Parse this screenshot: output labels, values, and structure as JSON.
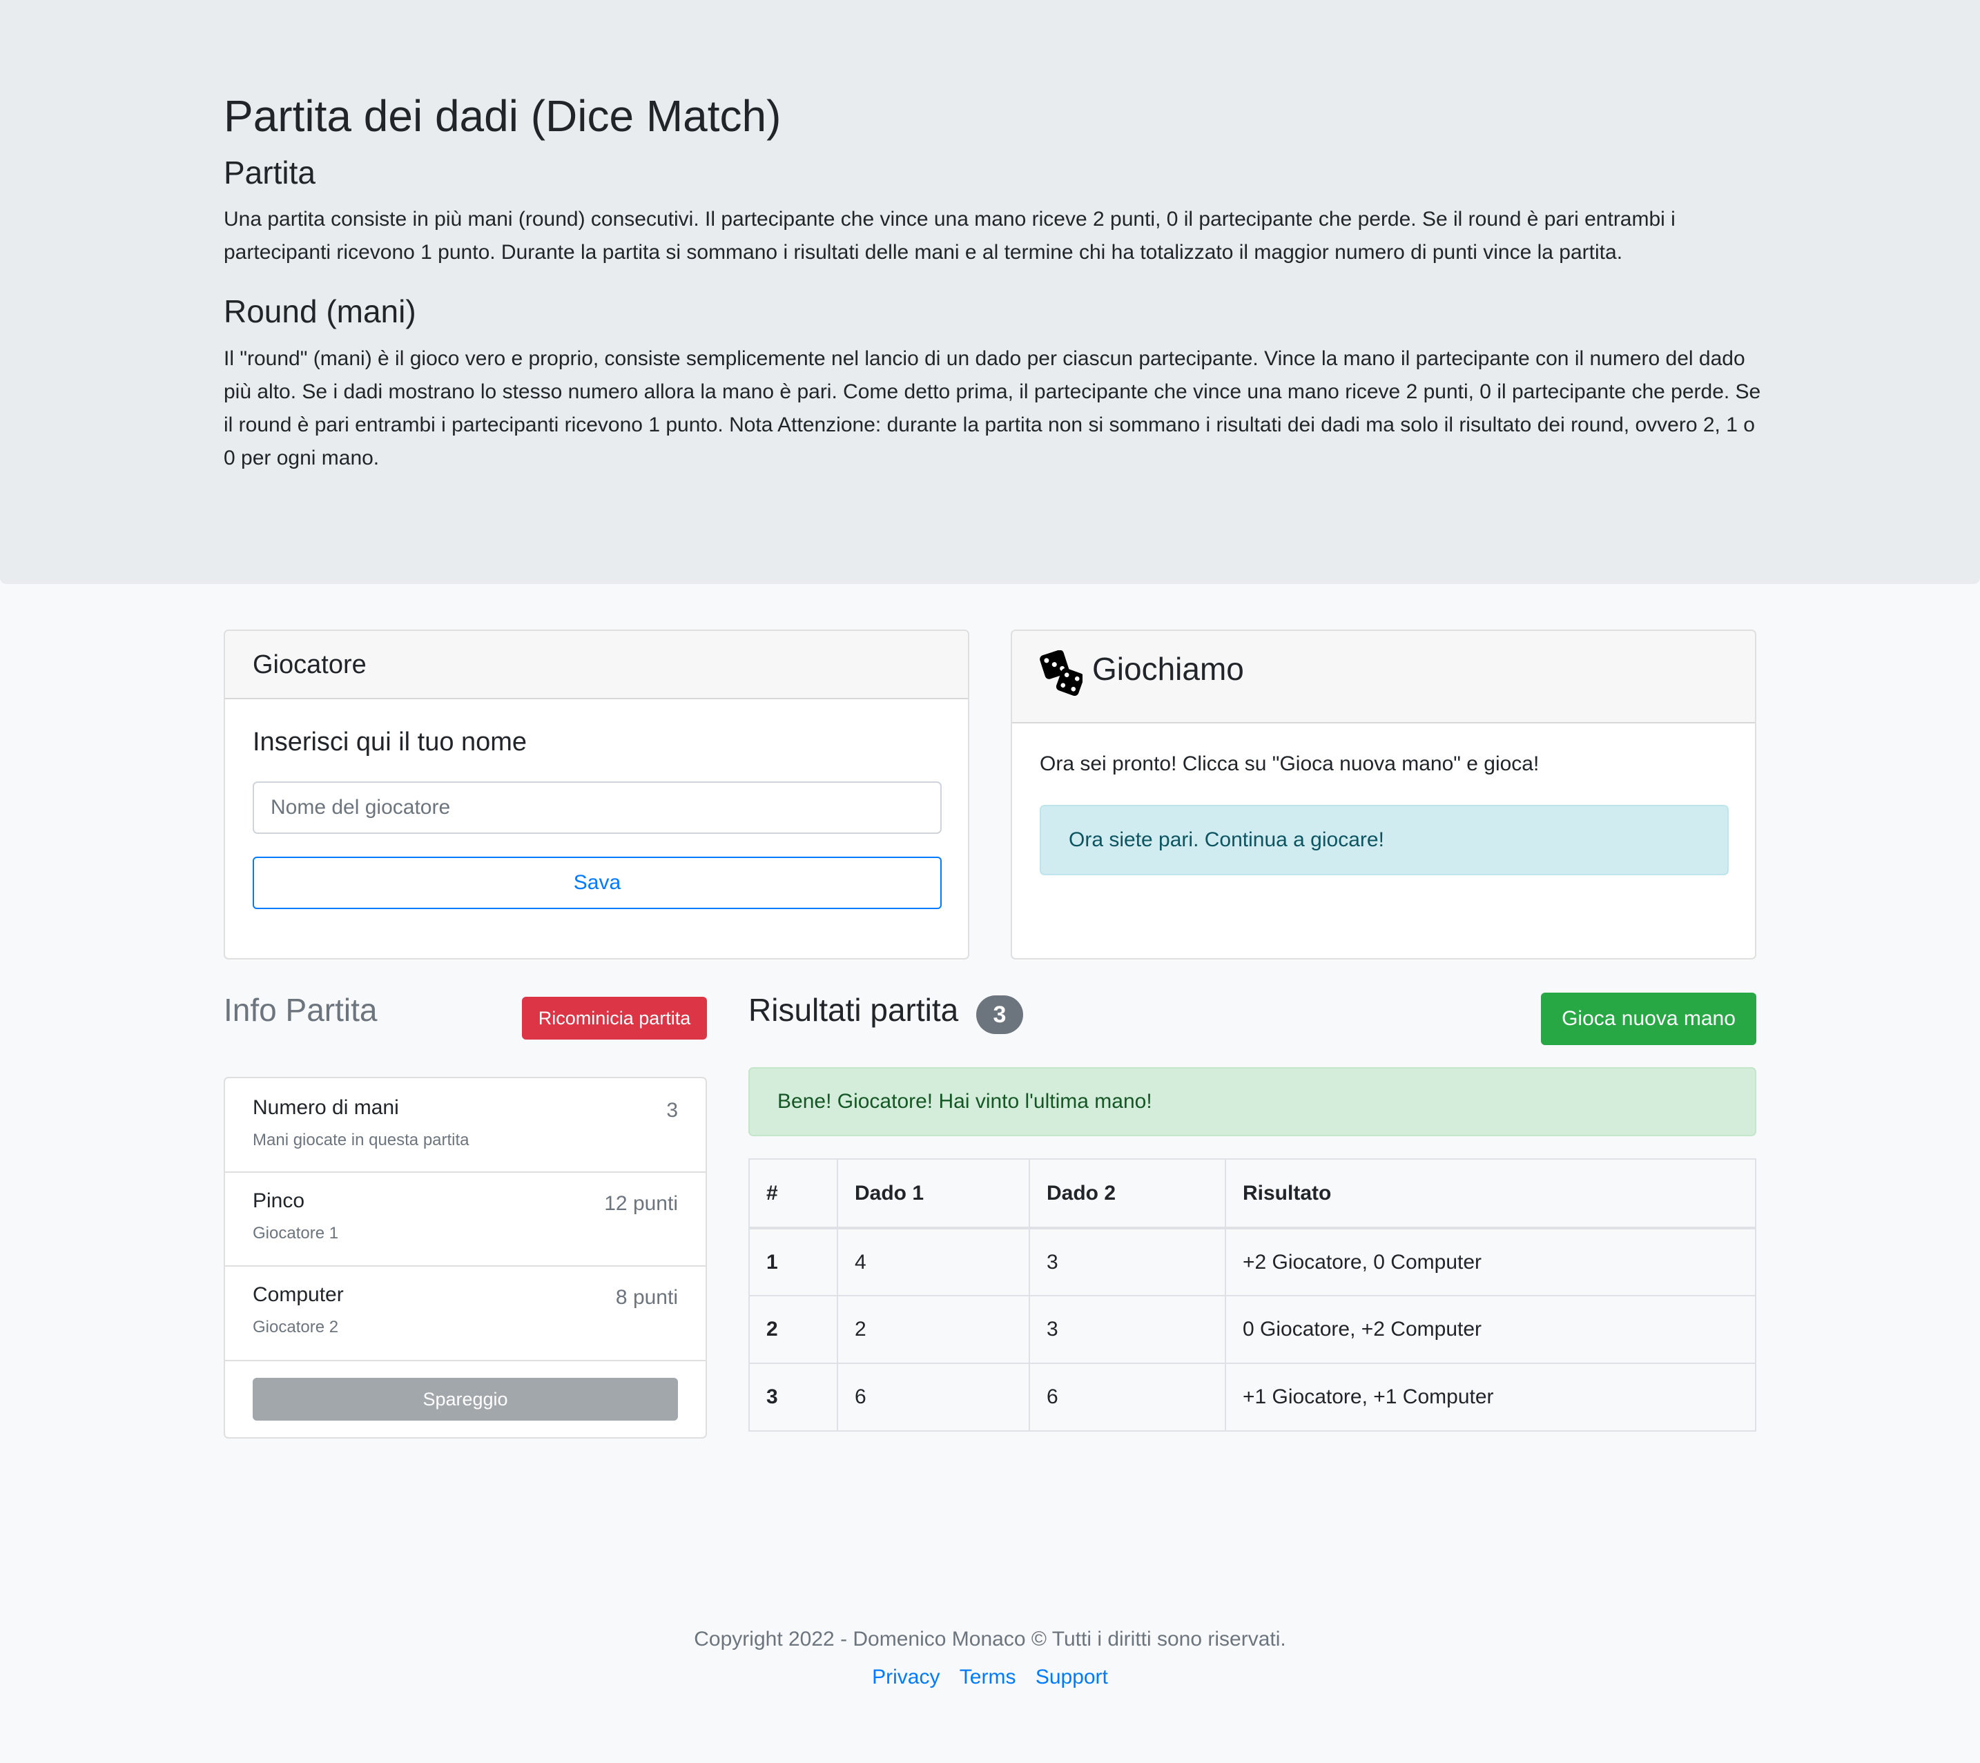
{
  "intro": {
    "title": "Partita dei dadi (Dice Match)",
    "section1_heading": "Partita",
    "section1_text": "Una partita consiste in più mani (round) consecutivi. Il partecipante che vince una mano riceve 2 punti, 0 il partecipante che perde. Se il round è pari entrambi i partecipanti ricevono 1 punto. Durante la partita si sommano i risultati delle mani e al termine chi ha totalizzato il maggior numero di punti vince la partita.",
    "section2_heading": "Round (mani)",
    "section2_text": "Il \"round\" (mani) è il gioco vero e proprio, consiste semplicemente nel lancio di un dado per ciascun partecipante. Vince la mano il partecipante con il numero del dado più alto. Se i dadi mostrano lo stesso numero allora la mano è pari. Come detto prima, il partecipante che vince una mano riceve 2 punti, 0 il partecipante che perde. Se il round è pari entrambi i partecipanti ricevono 1 punto. Nota Attenzione: durante la partita non si sommano i risultati dei dadi ma solo il risultato dei round, ovvero 2, 1 o 0 per ogni mano."
  },
  "player_card": {
    "header": "Giocatore",
    "heading": "Inserisci qui il tuo nome",
    "name_placeholder": "Nome del giocatore",
    "name_value": "",
    "save_label": "Sava"
  },
  "play_card": {
    "header": "Giochiamo",
    "icon": "dice-icon",
    "text": "Ora sei pronto! Clicca su \"Gioca nuova mano\" e gioca!",
    "alert": "Ora siete pari. Continua a giocare!"
  },
  "info": {
    "title": "Info Partita",
    "restart_label": "Ricominicia partita",
    "items": [
      {
        "title": "Numero di mani",
        "subtitle": "Mani giocate in questa partita",
        "value": "3"
      },
      {
        "title": "Pinco",
        "subtitle": "Giocatore 1",
        "value": "12 punti"
      },
      {
        "title": "Computer",
        "subtitle": "Giocatore 2",
        "value": "8 punti"
      }
    ],
    "tiebreak_label": "Spareggio"
  },
  "results": {
    "title": "Risultati partita",
    "count_badge": "3",
    "play_label": "Gioca nuova mano",
    "alert": "Bene! Giocatore! Hai vinto l'ultima mano!",
    "columns": [
      "#",
      "Dado 1",
      "Dado 2",
      "Risultato"
    ],
    "rows": [
      [
        "1",
        "4",
        "3",
        "+2 Giocatore, 0 Computer"
      ],
      [
        "2",
        "2",
        "3",
        "0 Giocatore, +2 Computer"
      ],
      [
        "3",
        "6",
        "6",
        "+1 Giocatore, +1 Computer"
      ]
    ]
  },
  "footer": {
    "copyright": "Copyright 2022 - Domenico Monaco © Tutti i diritti sono riservati.",
    "links": [
      "Privacy",
      "Terms",
      "Support"
    ]
  },
  "colors": {
    "primary": "#007bff",
    "danger": "#dc3545",
    "success": "#28a745",
    "secondary": "#6c757d"
  }
}
